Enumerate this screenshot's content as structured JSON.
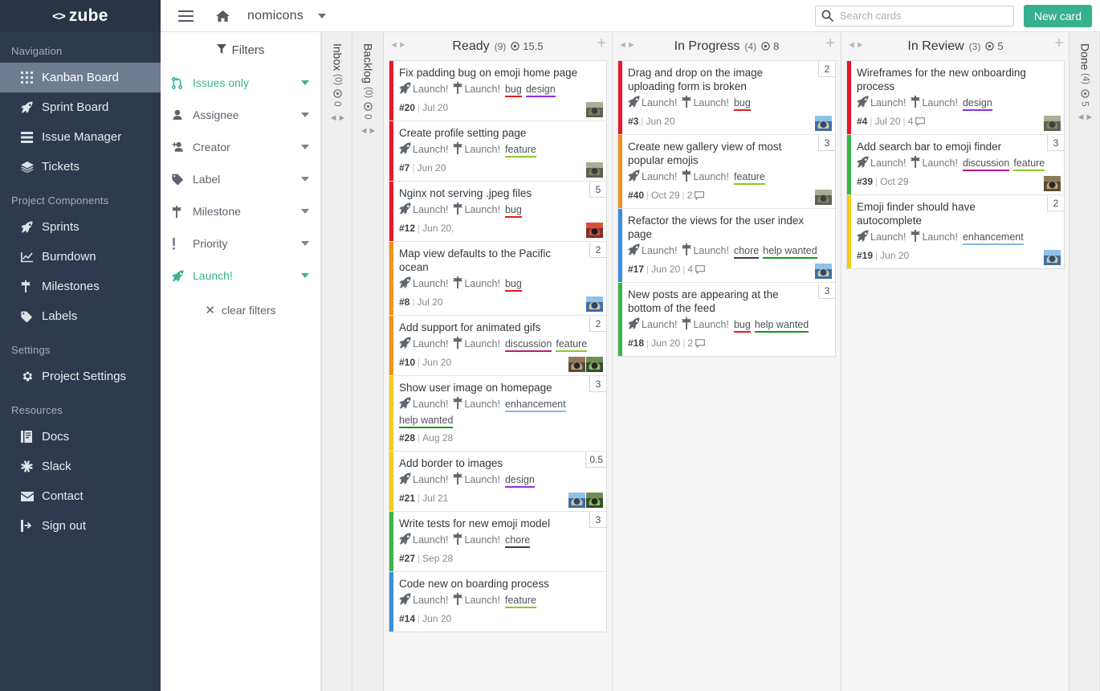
{
  "brand": {
    "chev": "<>",
    "name": "zube"
  },
  "topbar": {
    "project": "nomicons",
    "search_placeholder": "Search cards",
    "search_value": "",
    "new_card_label": "New card"
  },
  "sidebar": {
    "sections": [
      {
        "title": "Navigation",
        "items": [
          {
            "label": "Kanban Board",
            "icon": "grid-icon",
            "active": true
          },
          {
            "label": "Sprint Board",
            "icon": "rocket-icon",
            "active": false
          },
          {
            "label": "Issue Manager",
            "icon": "list-icon",
            "active": false
          },
          {
            "label": "Tickets",
            "icon": "tickets-icon",
            "active": false
          }
        ]
      },
      {
        "title": "Project Components",
        "items": [
          {
            "label": "Sprints",
            "icon": "rocket-icon",
            "active": false
          },
          {
            "label": "Burndown",
            "icon": "chart-icon",
            "active": false
          },
          {
            "label": "Milestones",
            "icon": "milestone-icon",
            "active": false
          },
          {
            "label": "Labels",
            "icon": "tag-icon",
            "active": false
          }
        ]
      },
      {
        "title": "Settings",
        "items": [
          {
            "label": "Project Settings",
            "icon": "gear-icon",
            "active": false
          }
        ]
      },
      {
        "title": "Resources",
        "items": [
          {
            "label": "Docs",
            "icon": "book-icon",
            "active": false
          },
          {
            "label": "Slack",
            "icon": "slack-icon",
            "active": false
          },
          {
            "label": "Contact",
            "icon": "mail-icon",
            "active": false
          },
          {
            "label": "Sign out",
            "icon": "signout-icon",
            "active": false
          }
        ]
      }
    ]
  },
  "filters": {
    "title": "Filters",
    "rows": [
      {
        "label": "Issues only",
        "icon": "pull-request-icon",
        "accent": true
      },
      {
        "label": "Assignee",
        "icon": "person-icon",
        "accent": false
      },
      {
        "label": "Creator",
        "icon": "person-add-icon",
        "accent": false
      },
      {
        "label": "Label",
        "icon": "tag-icon",
        "accent": false
      },
      {
        "label": "Milestone",
        "icon": "milestone-icon",
        "accent": false
      },
      {
        "label": "Priority",
        "icon": "exclamation-icon",
        "accent": false
      },
      {
        "label": "Launch!",
        "icon": "rocket-icon",
        "accent": true
      }
    ],
    "clear_label": "clear filters"
  },
  "label_colors": {
    "bug": "#e01b24",
    "design": "#8b2fe0",
    "feature": "#8ac926",
    "discussion": "#c2197a",
    "enhancement": "#84b6eb",
    "help wanted": "#159818",
    "chore": "#3b4049"
  },
  "priority_colors": {
    "red": "#e8192c",
    "orange": "#f0921e",
    "yellow": "#f5cb1b",
    "green": "#3cb44b",
    "blue": "#3b8ddd"
  },
  "collapsed_columns": [
    {
      "name": "Inbox",
      "count": "(0)",
      "points": "0"
    },
    {
      "name": "Backlog",
      "count": "(0)",
      "points": "0"
    }
  ],
  "done_column": {
    "name": "Done",
    "count": "(4)",
    "points": "5"
  },
  "columns": [
    {
      "name": "Ready",
      "count": "(9)",
      "points": "15.5",
      "cards": [
        {
          "title": "Fix padding bug on emoji home page",
          "sprint": "Launch!",
          "milestone": "Launch!",
          "labels": [
            "bug",
            "design"
          ],
          "id": "#20",
          "date": "Jul 20",
          "comments": "",
          "points": "",
          "priority": "red",
          "avatars": [
            "dog"
          ]
        },
        {
          "title": "Create profile setting page",
          "sprint": "Launch!",
          "milestone": "Launch!",
          "labels": [
            "feature"
          ],
          "id": "#7",
          "date": "Jun 20",
          "comments": "",
          "points": "",
          "priority": "red",
          "avatars": [
            "dog"
          ]
        },
        {
          "title": "Nginx not serving .jpeg files",
          "sprint": "Launch!",
          "milestone": "Launch!",
          "labels": [
            "bug"
          ],
          "id": "#12",
          "date": "Jun 20,",
          "comments": "",
          "points": "5",
          "priority": "red",
          "avatars": [
            "red"
          ]
        },
        {
          "title": "Map view defaults to the Pacific ocean",
          "sprint": "Launch!",
          "milestone": "Launch!",
          "labels": [
            "bug"
          ],
          "id": "#8",
          "date": "Jul 20",
          "comments": "",
          "points": "2",
          "priority": "orange",
          "avatars": [
            "blue"
          ]
        },
        {
          "title": "Add support for animated gifs",
          "sprint": "Launch!",
          "milestone": "Launch!",
          "labels": [
            "discussion",
            "feature"
          ],
          "id": "#10",
          "date": "Jun 20",
          "comments": "",
          "points": "2",
          "priority": "orange",
          "avatars": [
            "wave",
            "green"
          ]
        },
        {
          "title": "Show user image on homepage",
          "sprint": "Launch!",
          "milestone": "Launch!",
          "labels": [
            "enhancement",
            "help wanted"
          ],
          "id": "#28",
          "date": "Aug 28",
          "comments": "",
          "points": "3",
          "priority": "yellow",
          "avatars": []
        },
        {
          "title": "Add border to images",
          "sprint": "Launch!",
          "milestone": "Launch!",
          "labels": [
            "design"
          ],
          "id": "#21",
          "date": "Jul 21",
          "comments": "",
          "points": "0.5",
          "priority": "yellow",
          "avatars": [
            "blue",
            "green"
          ]
        },
        {
          "title": "Write tests for new emoji model",
          "sprint": "Launch!",
          "milestone": "Launch!",
          "labels": [
            "chore"
          ],
          "id": "#27",
          "date": "Sep 28",
          "comments": "",
          "points": "3",
          "priority": "green",
          "avatars": []
        },
        {
          "title": "Code new on boarding process",
          "sprint": "Launch!",
          "milestone": "Launch!",
          "labels": [
            "feature"
          ],
          "id": "#14",
          "date": "Jun 20",
          "comments": "",
          "points": "",
          "priority": "blue",
          "avatars": []
        }
      ]
    },
    {
      "name": "In Progress",
      "count": "(4)",
      "points": "8",
      "cards": [
        {
          "title": "Drag and drop on the image uploading form is broken",
          "sprint": "Launch!",
          "milestone": "Launch!",
          "labels": [
            "bug"
          ],
          "id": "#3",
          "date": "Jun 20",
          "comments": "",
          "points": "2",
          "priority": "red",
          "avatars": [
            "blue"
          ]
        },
        {
          "title": "Create new gallery view of most popular emojis",
          "sprint": "Launch!",
          "milestone": "Launch!",
          "labels": [
            "feature"
          ],
          "id": "#40",
          "date": "Oct 29",
          "comments": "2",
          "points": "3",
          "priority": "orange",
          "avatars": [
            "dog"
          ]
        },
        {
          "title": "Refactor the views for the user index page",
          "sprint": "Launch!",
          "milestone": "Launch!",
          "labels": [
            "chore",
            "help wanted"
          ],
          "id": "#17",
          "date": "Jun 20",
          "comments": "4",
          "points": "",
          "priority": "blue",
          "avatars": [
            "blue"
          ]
        },
        {
          "title": "New posts are appearing at the bottom of the feed",
          "sprint": "Launch!",
          "milestone": "Launch!",
          "labels": [
            "bug",
            "help wanted"
          ],
          "id": "#18",
          "date": "Jun 20",
          "comments": "2",
          "points": "3",
          "priority": "green",
          "avatars": []
        }
      ]
    },
    {
      "name": "In Review",
      "count": "(3)",
      "points": "5",
      "cards": [
        {
          "title": "Wireframes for the new onboarding process",
          "sprint": "Launch!",
          "milestone": "Launch!",
          "labels": [
            "design"
          ],
          "id": "#4",
          "date": "Jul 20",
          "comments": "4",
          "points": "",
          "priority": "red",
          "avatars": [
            "dog"
          ]
        },
        {
          "title": "Add search bar to emoji finder",
          "sprint": "Launch!",
          "milestone": "Launch!",
          "labels": [
            "discussion",
            "feature"
          ],
          "id": "#39",
          "date": "Oct 29",
          "comments": "",
          "points": "3",
          "priority": "green",
          "avatars": [
            "wave"
          ]
        },
        {
          "title": "Emoji finder should have autocomplete",
          "sprint": "Launch!",
          "milestone": "Launch!",
          "labels": [
            "enhancement"
          ],
          "id": "#19",
          "date": "Jun 20",
          "comments": "",
          "points": "2",
          "priority": "yellow",
          "avatars": [
            "blue"
          ]
        }
      ]
    }
  ]
}
